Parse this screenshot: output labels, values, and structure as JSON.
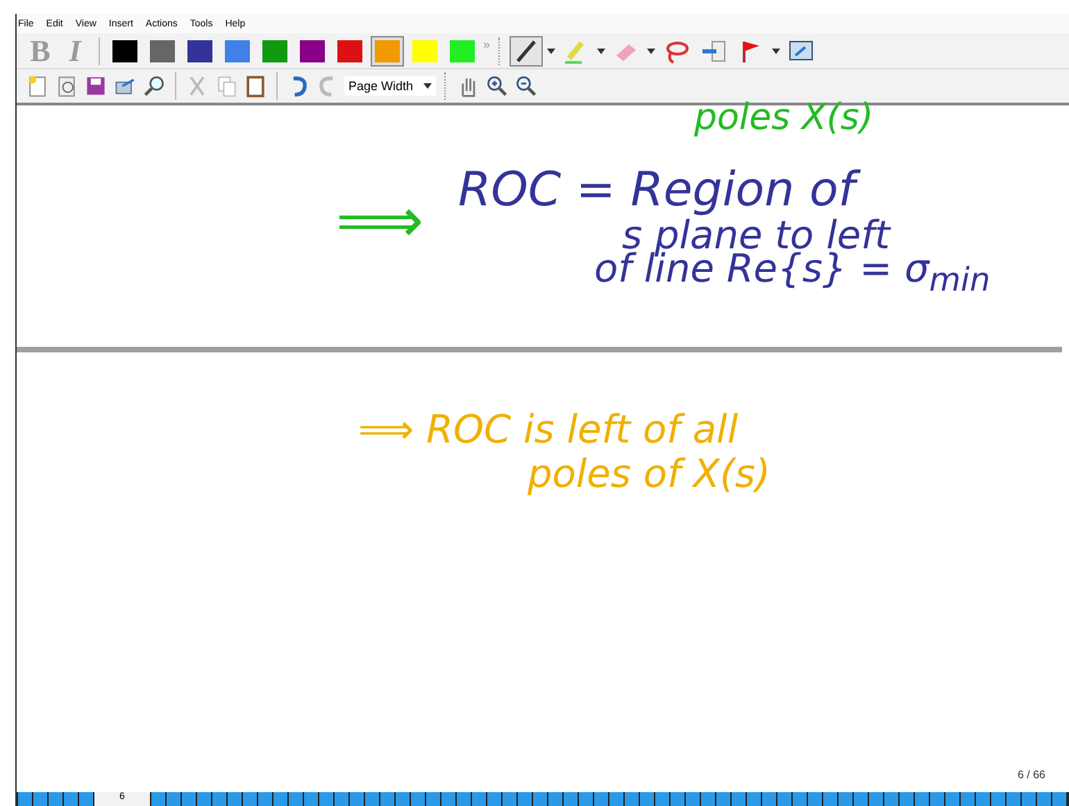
{
  "menu": [
    "File",
    "Edit",
    "View",
    "Insert",
    "Actions",
    "Tools",
    "Help"
  ],
  "format_buttons": [
    {
      "label": "B",
      "disabled": true
    },
    {
      "label": "I",
      "disabled": true
    }
  ],
  "colors": [
    {
      "color": "#000000",
      "selected": false
    },
    {
      "color": "#666666",
      "selected": false
    },
    {
      "color": "#333399",
      "selected": false
    },
    {
      "color": "#4080e8",
      "selected": false
    },
    {
      "color": "#119911",
      "selected": false
    },
    {
      "color": "#880088",
      "selected": false
    },
    {
      "color": "#dd1111",
      "selected": false
    },
    {
      "color": "#f09a00",
      "selected": true
    },
    {
      "color": "#ffff00",
      "selected": false
    },
    {
      "color": "#22ee22",
      "selected": false
    }
  ],
  "overflow": "»",
  "tools": [
    {
      "kind": "pen",
      "selected": true
    },
    {
      "kind": "highlighter",
      "selected": false
    },
    {
      "kind": "eraser",
      "selected": false
    },
    {
      "kind": "lasso",
      "selected": false
    },
    {
      "kind": "insert",
      "selected": false
    },
    {
      "kind": "flag",
      "selected": false
    },
    {
      "kind": "screen",
      "selected": false
    }
  ],
  "zoom": {
    "value": "Page Width"
  },
  "notes": [
    {
      "text": "poles X(s)",
      "color": "#22bb22"
    },
    {
      "text": "⟹",
      "color": "#22bb22"
    },
    {
      "text": "ROC = Region of",
      "color": "#333399"
    },
    {
      "text": "s plane to left",
      "color": "#333399"
    },
    {
      "text": "of line Re{s} = σ$_{min}$",
      "color": "#333399"
    },
    {
      "text": "⟹ ROC is left of  all",
      "color": "#f0b000"
    },
    {
      "text": "poles of X(s)",
      "color": "#f0b000"
    }
  ],
  "page_indicator": "6 / 66",
  "current_page": "6"
}
